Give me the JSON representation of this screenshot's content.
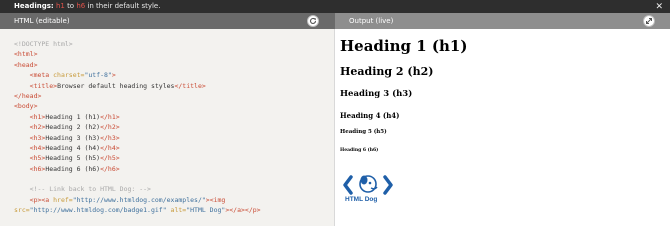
{
  "banner": {
    "lead": "Headings:",
    "tag_start": "h1",
    "mid": "to",
    "tag_end": "h6",
    "tail": "in their default style.",
    "close_glyph": "✕"
  },
  "editor_panel": {
    "title": "HTML (editable)",
    "action_icon": "refresh-icon"
  },
  "output_panel": {
    "title": "Output (live)",
    "action_icon": "expand-icon"
  },
  "code_lines": [
    [
      [
        "cmt",
        "<!DOCTYPE html>"
      ]
    ],
    [
      [
        "tag",
        "<html>"
      ]
    ],
    [
      [
        "tag",
        "<head>"
      ]
    ],
    [
      [
        "txt",
        "    "
      ],
      [
        "tag",
        "<meta "
      ],
      [
        "attr",
        "charset="
      ],
      [
        "str",
        "\"utf-8\""
      ],
      [
        "tag",
        ">"
      ]
    ],
    [
      [
        "txt",
        "    "
      ],
      [
        "tag",
        "<title>"
      ],
      [
        "txt",
        "Browser default heading styles"
      ],
      [
        "tag",
        "</title>"
      ]
    ],
    [
      [
        "tag",
        "</head>"
      ]
    ],
    [
      [
        "tag",
        "<body>"
      ]
    ],
    [
      [
        "txt",
        "    "
      ],
      [
        "tag",
        "<h1>"
      ],
      [
        "txt",
        "Heading 1 (h1)"
      ],
      [
        "tag",
        "</h1>"
      ]
    ],
    [
      [
        "txt",
        "    "
      ],
      [
        "tag",
        "<h2>"
      ],
      [
        "txt",
        "Heading 2 (h2)"
      ],
      [
        "tag",
        "</h2>"
      ]
    ],
    [
      [
        "txt",
        "    "
      ],
      [
        "tag",
        "<h3>"
      ],
      [
        "txt",
        "Heading 3 (h3)"
      ],
      [
        "tag",
        "</h3>"
      ]
    ],
    [
      [
        "txt",
        "    "
      ],
      [
        "tag",
        "<h4>"
      ],
      [
        "txt",
        "Heading 4 (h4)"
      ],
      [
        "tag",
        "</h4>"
      ]
    ],
    [
      [
        "txt",
        "    "
      ],
      [
        "tag",
        "<h5>"
      ],
      [
        "txt",
        "Heading 5 (h5)"
      ],
      [
        "tag",
        "</h5>"
      ]
    ],
    [
      [
        "txt",
        "    "
      ],
      [
        "tag",
        "<h6>"
      ],
      [
        "txt",
        "Heading 6 (h6)"
      ],
      [
        "tag",
        "</h6>"
      ]
    ],
    [],
    [
      [
        "txt",
        "    "
      ],
      [
        "cmt",
        "<!-- Link back to HTML Dog: -->"
      ]
    ],
    [
      [
        "txt",
        "    "
      ],
      [
        "tag",
        "<p><a "
      ],
      [
        "attr",
        "href="
      ],
      [
        "str",
        "\"http://www.htmldog.com/examples/\""
      ],
      [
        "tag",
        "><img"
      ]
    ],
    [
      [
        "attr",
        "src="
      ],
      [
        "str",
        "\"http://www.htmldog.com/badge1.gif\""
      ],
      [
        "txt",
        " "
      ],
      [
        "attr",
        "alt="
      ],
      [
        "str",
        "\"HTML Dog\""
      ],
      [
        "tag",
        "></a></p>"
      ]
    ]
  ],
  "output": {
    "h1": "Heading 1 (h1)",
    "h2": "Heading 2 (h2)",
    "h3": "Heading 3 (h3)",
    "h4": "Heading 4 (h4)",
    "h5": "Heading 5 (h5)",
    "h6": "Heading 6 (h6)",
    "badge_text": "HTML Dog"
  },
  "colors": {
    "tag": "#c94a33",
    "comment": "#a8a8a8",
    "attribute": "#c79a3a",
    "string": "#3d6f9c",
    "badge_blue": "#1f5fa8"
  }
}
